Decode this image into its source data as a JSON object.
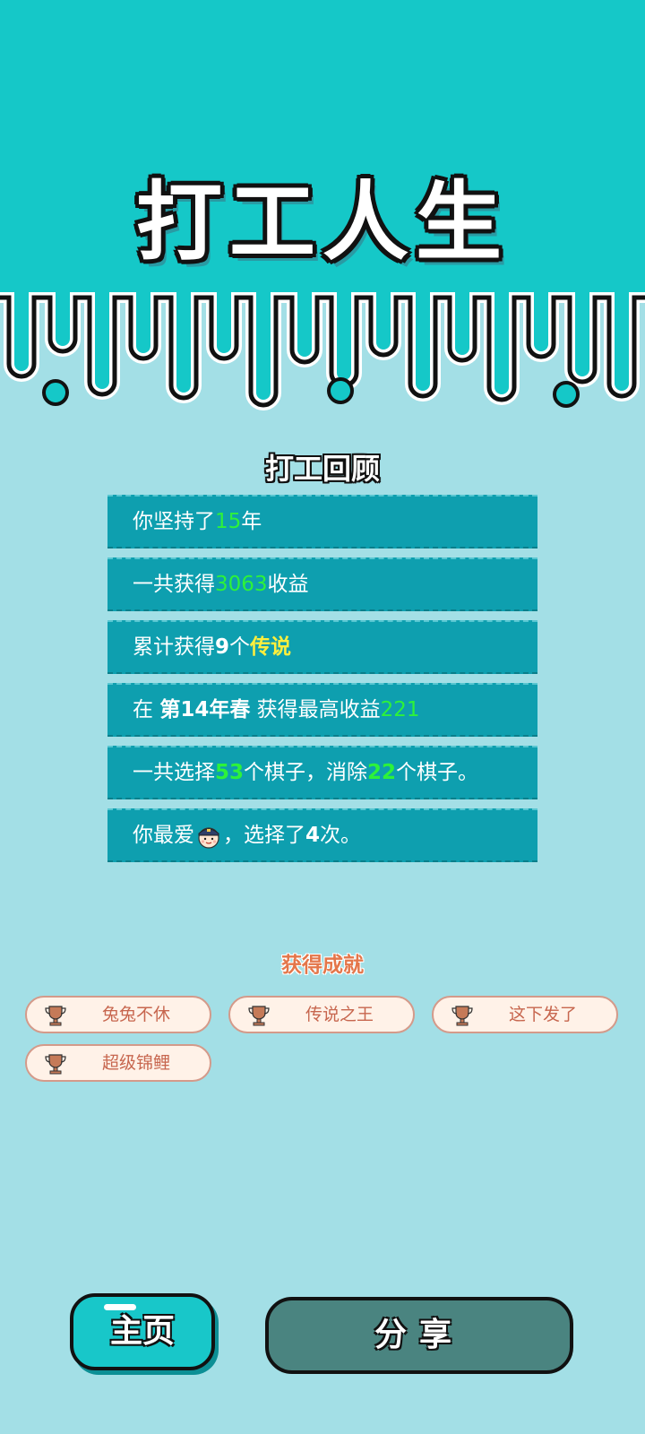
{
  "colors": {
    "top_bg": "#15c8c8",
    "bottom_bg": "#a3dfe6",
    "row_bg": "#0e9faf",
    "green": "#2df23a",
    "yellow": "#ffef3c",
    "achievement": "#e4764a"
  },
  "title": "打工人生",
  "review": {
    "heading": "打工回顾",
    "rows": [
      {
        "a": "你坚持了",
        "years": "15",
        "b": "年"
      },
      {
        "a": "一共获得",
        "income": "3063",
        "b": "收益"
      },
      {
        "a": "累计获得",
        "count": "9",
        "c": "个",
        "legend": "传说"
      },
      {
        "a": "在 ",
        "period": "第14年春",
        "b": " 获得最高收益",
        "max": "221"
      },
      {
        "a": "一共选择",
        "chosen": "53",
        "b": "个棋子，消除",
        "removed": "22",
        "c": "个棋子。"
      },
      {
        "a": "你最爱",
        "favorite_icon": "police-officer-icon",
        "b": "，选择了",
        "times": "4",
        "c": "次。"
      }
    ]
  },
  "achievements": {
    "heading": "获得成就",
    "items": [
      {
        "label": "兔兔不休",
        "icon": "trophy-icon"
      },
      {
        "label": "传说之王",
        "icon": "trophy-icon"
      },
      {
        "label": "这下发了",
        "icon": "trophy-icon"
      },
      {
        "label": "超级锦鲤",
        "icon": "trophy-icon"
      }
    ]
  },
  "buttons": {
    "home": "主页",
    "share": "分享"
  }
}
